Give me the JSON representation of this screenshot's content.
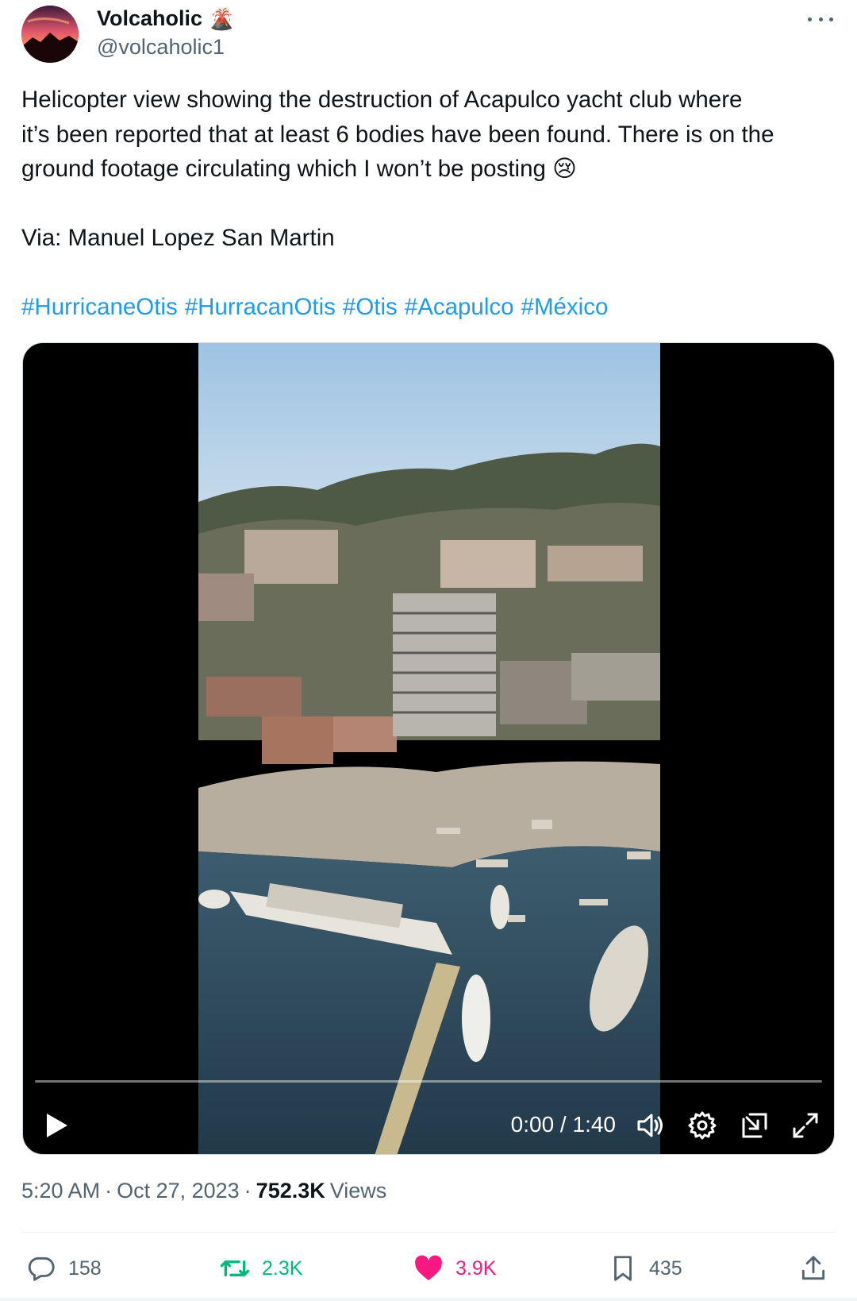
{
  "author": {
    "display_name": "Volcaholic",
    "badge_emoji": "🌋",
    "handle": "@volcaholic1",
    "avatar_icon": "sunset-avatar"
  },
  "tweet": {
    "line1": "Helicopter view showing the destruction of Acapulco yacht club where",
    "line2": "it’s been reported that at least 6 bodies have been found. There is on the",
    "line3": "ground footage circulating which I won’t be posting 😢",
    "via": "Via: Manuel Lopez San Martin",
    "hashtags": [
      "#HurricaneOtis",
      "#HurracanOtis",
      "#Otis",
      "#Acapulco",
      "#México"
    ]
  },
  "video": {
    "current_time": "0:00",
    "duration": "1:40",
    "time_display": "0:00 / 1:40",
    "progress": 0
  },
  "meta": {
    "time": "5:20 AM",
    "separator": "·",
    "date": "Oct 27, 2023",
    "views_count": "752.3K",
    "views_label": "Views"
  },
  "actions": {
    "replies": "158",
    "reposts": "2.3K",
    "likes": "3.9K",
    "bookmarks": "435"
  },
  "colors": {
    "link": "#1d9bf0",
    "repost": "#00ba7c",
    "like": "#f91880",
    "secondary_text": "#536471"
  }
}
